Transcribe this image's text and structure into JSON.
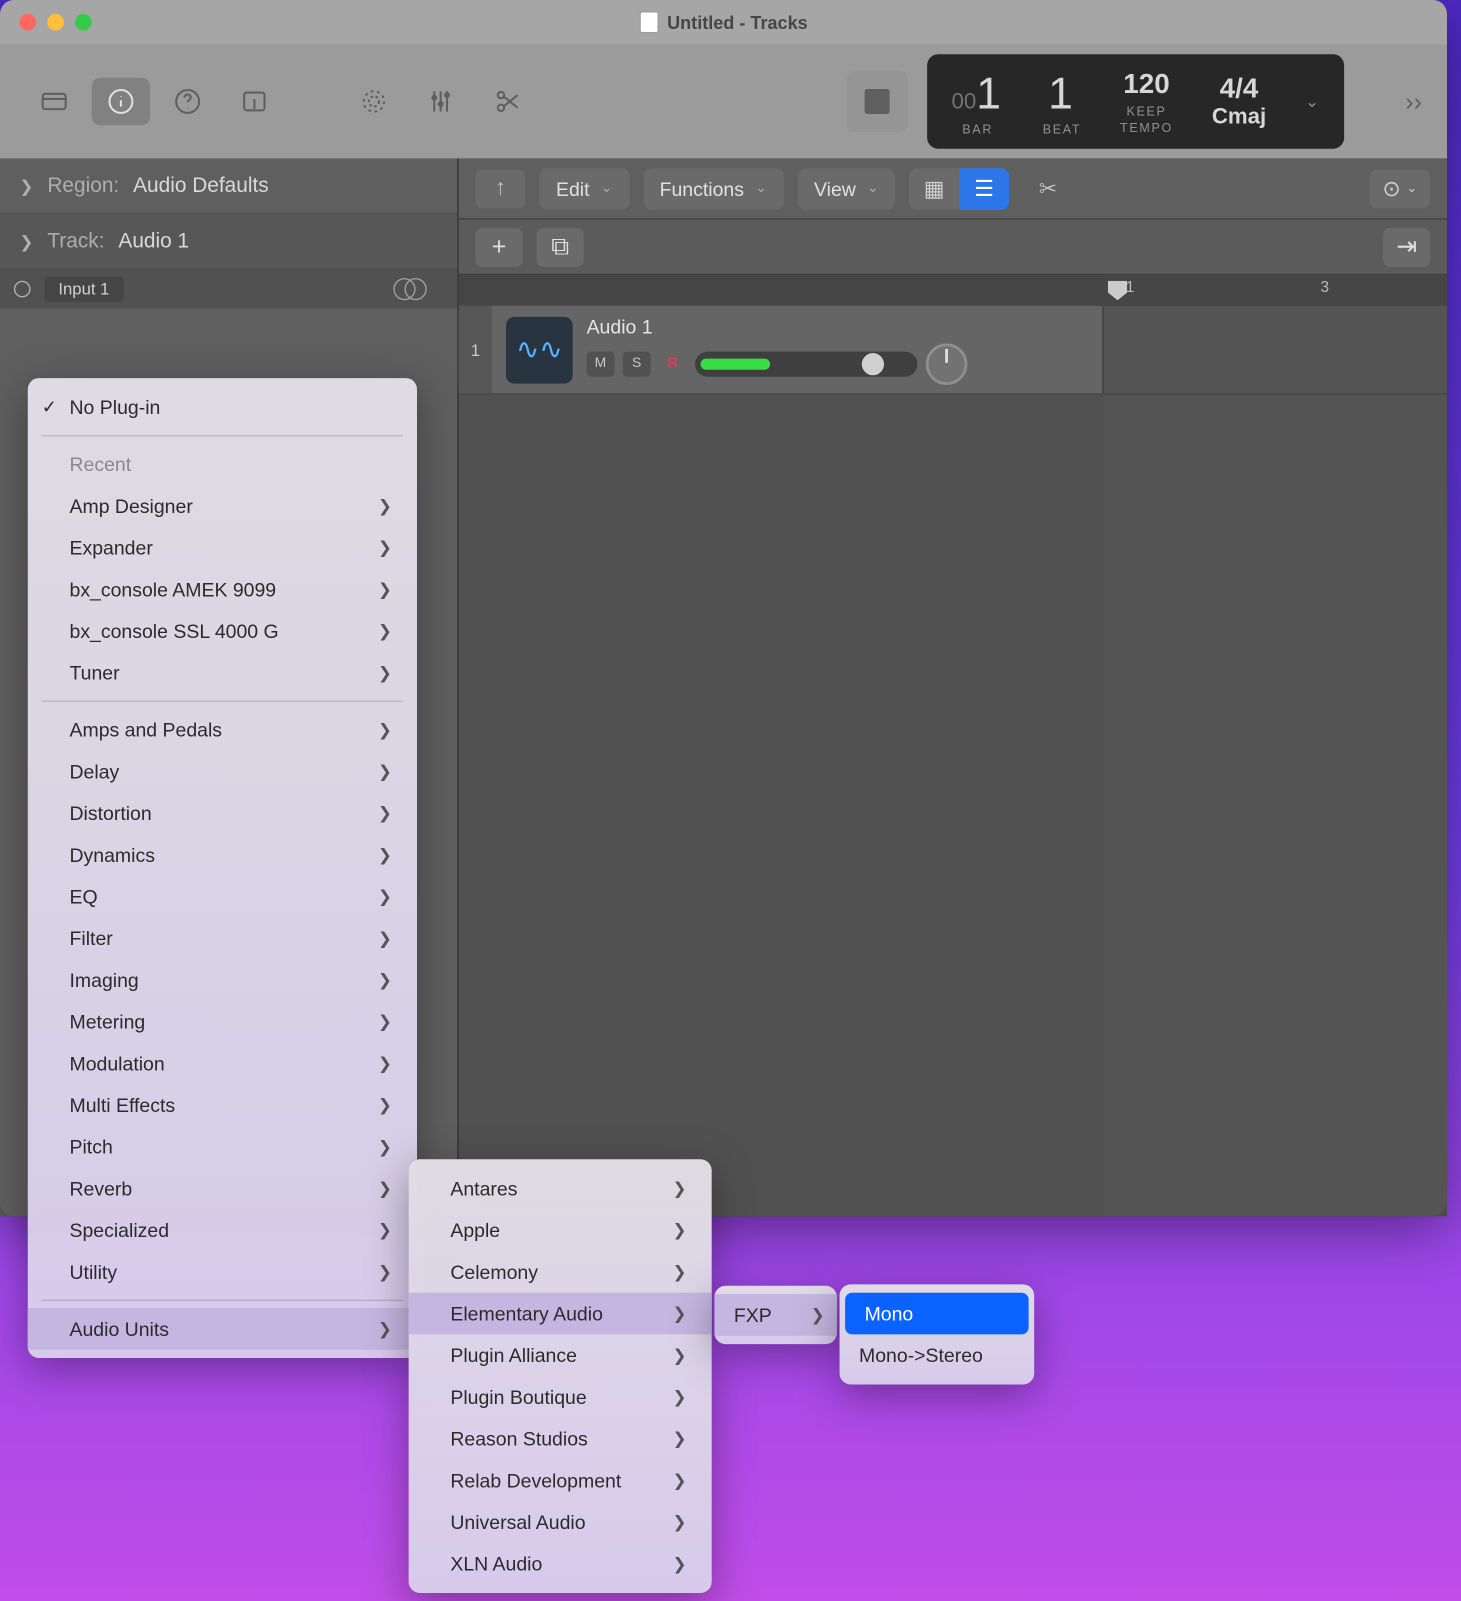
{
  "window": {
    "title": "Untitled - Tracks"
  },
  "lcd": {
    "bar_value": "00",
    "bar_big": "1",
    "bar_label": "BAR",
    "beat_value": "1",
    "beat_label": "BEAT",
    "tempo_value": "120",
    "tempo_keep": "KEEP",
    "tempo_label": "TEMPO",
    "sig_value": "4/4",
    "key_value": "Cmaj"
  },
  "inspector": {
    "region_label": "Region:",
    "region_value": "Audio Defaults",
    "track_label": "Track:",
    "track_value": "Audio 1",
    "input_label": "Input 1"
  },
  "arrange": {
    "edit": "Edit",
    "functions": "Functions",
    "view": "View",
    "ruler": {
      "one": "1",
      "three": "3"
    }
  },
  "track": {
    "number": "1",
    "name": "Audio 1",
    "mute": "M",
    "solo": "S",
    "rec": "R"
  },
  "menu1": {
    "no_plugin": "No Plug-in",
    "recent": "Recent",
    "recents": [
      "Amp Designer",
      "Expander",
      "bx_console AMEK 9099",
      "bx_console SSL 4000 G",
      "Tuner"
    ],
    "cats": [
      "Amps and Pedals",
      "Delay",
      "Distortion",
      "Dynamics",
      "EQ",
      "Filter",
      "Imaging",
      "Metering",
      "Modulation",
      "Multi Effects",
      "Pitch",
      "Reverb",
      "Specialized",
      "Utility"
    ],
    "au": "Audio Units"
  },
  "menu2": {
    "items": [
      "Antares",
      "Apple",
      "Celemony",
      "Elementary Audio",
      "Plugin Alliance",
      "Plugin Boutique",
      "Reason Studios",
      "Relab Development",
      "Universal Audio",
      "XLN Audio"
    ],
    "selected_index": 3
  },
  "menu3": {
    "item": "FXP"
  },
  "menu4": {
    "items": [
      "Mono",
      "Mono->Stereo"
    ],
    "selected_index": 0
  }
}
